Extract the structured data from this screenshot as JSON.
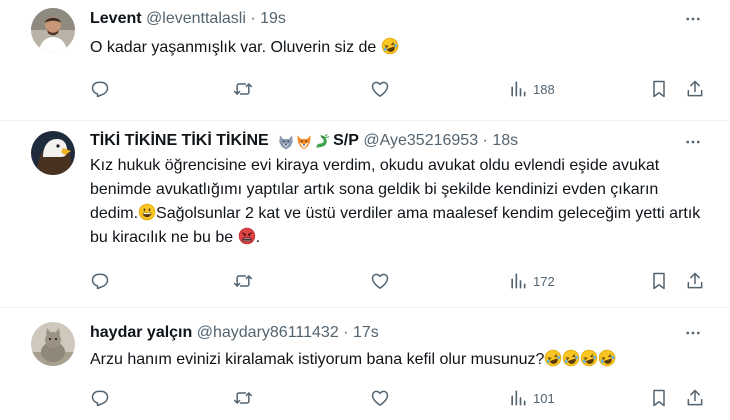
{
  "tweets": [
    {
      "name": "Levent",
      "handle": "@leventtalasli",
      "dot": "·",
      "time": "19s",
      "text": "O kadar yaşanmışlık var. Oluverin siz de",
      "views": "188"
    },
    {
      "name": "TİKİ TİKİNE TİKİ TİKİNE",
      "name_suffix": "S/P",
      "handle": "@Aye35216953",
      "dot": "·",
      "time": "18s",
      "text_1": "Kız hukuk öğrencisine evi kiraya verdim, okudu avukat oldu evlendi  eşide avukat benimde avukatlığımı yaptılar artık sona geldik bi şekilde kendinizi evden çıkarın dedim.",
      "text_2": "Sağolsunlar 2 kat ve üstü verdiler ama maalesef kendim geleceğim yetti artık bu kiracılık ne bu be",
      "text_3": ".",
      "views": "172"
    },
    {
      "name": "haydar yalçın",
      "handle": "@haydary86111432",
      "dot": "·",
      "time": "17s",
      "text": "Arzu hanım evinizi kiralamak istiyorum bana kefil olur musunuz?",
      "views": "101"
    }
  ],
  "colors": {
    "text": "#0f1419",
    "secondary": "#536471",
    "separator": "#eff3f4"
  },
  "icons": [
    "reply-icon",
    "retweet-icon",
    "like-icon",
    "views-icon",
    "bookmark-icon",
    "share-icon",
    "more-icon",
    "laughing-emoji",
    "grinning-emoji",
    "angry-symbols-emoji",
    "wolf-emoji",
    "fox-emoji",
    "dragon-emoji"
  ]
}
